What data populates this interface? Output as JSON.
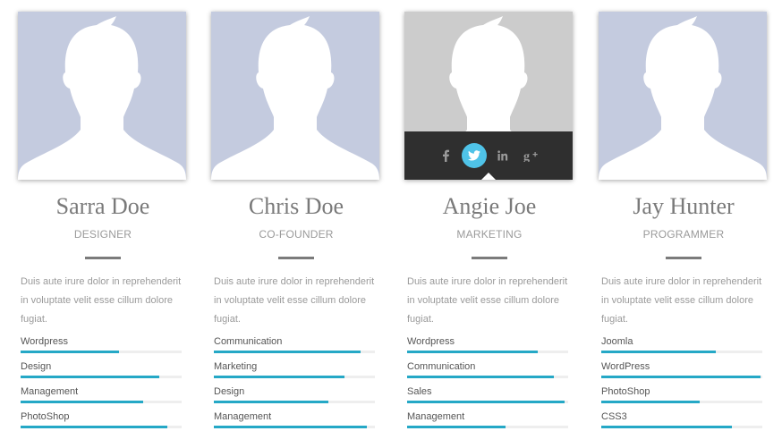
{
  "colors": {
    "accent": "#25a8c6",
    "photo_bg": "#c4cbdf",
    "overlay": "#2f2f2f",
    "twitter": "#4fc3e8"
  },
  "members": [
    {
      "name": "Sarra Doe",
      "role": "DESIGNER",
      "description": "Duis aute irure dolor in reprehenderit in voluptate velit esse cillum dolore fugiat.",
      "skills": [
        {
          "label": "Wordpress",
          "level": 0.61
        },
        {
          "label": "Design",
          "level": 0.86
        },
        {
          "label": "Management",
          "level": 0.76
        },
        {
          "label": "PhotoShop",
          "level": 0.91
        }
      ]
    },
    {
      "name": "Chris Doe",
      "role": "CO-FOUNDER",
      "description": "Duis aute irure dolor in reprehenderit in voluptate velit esse cillum dolore fugiat.",
      "skills": [
        {
          "label": "Communication",
          "level": 0.91
        },
        {
          "label": "Marketing",
          "level": 0.81
        },
        {
          "label": "Design",
          "level": 0.71
        },
        {
          "label": "Management",
          "level": 0.95
        }
      ]
    },
    {
      "name": "Angie Joe",
      "role": "MARKETING",
      "description": "Duis aute irure dolor in reprehenderit in voluptate velit esse cillum dolore fugiat.",
      "social": [
        "facebook-icon",
        "twitter-icon",
        "linkedin-icon",
        "google-plus-icon"
      ],
      "skills": [
        {
          "label": "Wordpress",
          "level": 0.81
        },
        {
          "label": "Communication",
          "level": 0.91
        },
        {
          "label": "Sales",
          "level": 0.98
        },
        {
          "label": "Management",
          "level": 0.61
        }
      ]
    },
    {
      "name": "Jay Hunter",
      "role": "PROGRAMMER",
      "description": "Duis aute irure dolor in reprehenderit in voluptate velit esse cillum dolore fugiat.",
      "skills": [
        {
          "label": "Joomla",
          "level": 0.71
        },
        {
          "label": "WordPress",
          "level": 0.99
        },
        {
          "label": "PhotoShop",
          "level": 0.61
        },
        {
          "label": "CSS3",
          "level": 0.81
        }
      ]
    }
  ]
}
